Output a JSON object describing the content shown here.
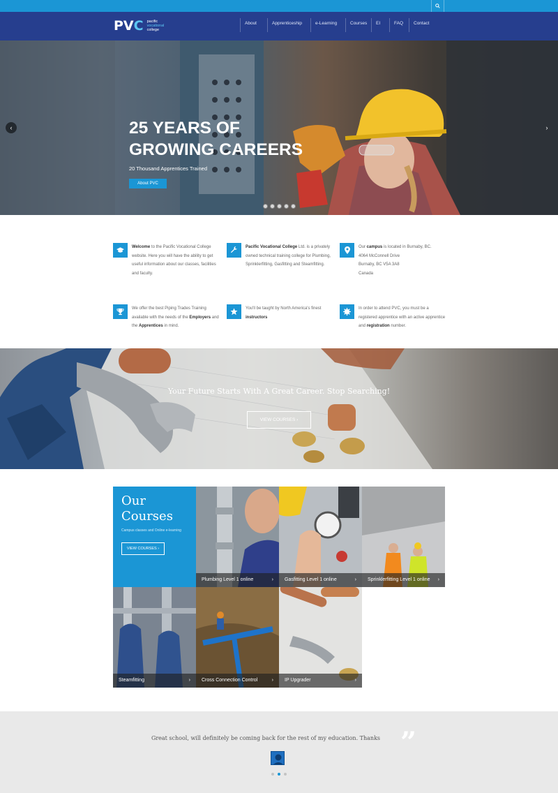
{
  "header": {
    "logo_mark_left": "PV",
    "logo_mark_right": "C",
    "logo_line1": "pacific",
    "logo_line2": "vocational",
    "logo_line3": "college",
    "nav": [
      "About",
      "Apprenticeship",
      "e-Learning",
      "Courses",
      "EI",
      "FAQ",
      "Contact"
    ]
  },
  "hero": {
    "title_line1": "25 YEARS OF",
    "title_line2": "GROWING CAREERS",
    "subtitle": "20 Thousand Apprentices Trained",
    "button": "About PVC",
    "slide_count": 5
  },
  "features": [
    {
      "icon": "graduation-cap-icon",
      "bold": "Welcome",
      "text": " to the Pacific Vocational College website. Here you will have the ability to get useful information about our classes, facilities and faculty."
    },
    {
      "icon": "wrench-icon",
      "bold": "Pacific Vocational College",
      "text": " Ltd. is a privately owned technical training college for Plumbing, Sprinklerfitting, Gasfitting and Steamfitting."
    },
    {
      "icon": "map-pin-icon",
      "pre": "Our ",
      "bold": "campus",
      "text": " is located in Burnaby, BC.",
      "lines": [
        "4064 McConnell Drive",
        "Burnaby, BC V5A 3A8",
        "Canada"
      ]
    },
    {
      "icon": "trophy-icon",
      "pre": "We offer the best Piping Trades Training available with the needs of the ",
      "bold": "Employers",
      "mid": " and the ",
      "bold2": "Apprentices",
      "text": " in mind."
    },
    {
      "icon": "star-icon",
      "pre": "You'll be taught by North America's finest ",
      "bold": "instructors",
      "text": ""
    },
    {
      "icon": "badge-icon",
      "pre": "In order to attend PVC, you must be a registered apprentice with an active apprentice and ",
      "bold": "registration",
      "text": " number."
    }
  ],
  "cta": {
    "title": "Your Future Starts With A Great Career. Stop Searching!",
    "button": "VIEW COURSES",
    "button_chevron": "›"
  },
  "courses": {
    "title_line1": "Our",
    "title_line2": "Courses",
    "subtitle": "Campus classes and Online e-learning",
    "button": "VIEW COURSES",
    "items": [
      {
        "label": "Plumbing Level 1 online"
      },
      {
        "label": "Gasfitting Level 1 online"
      },
      {
        "label": "Sprinklerfitting Level 1 online"
      },
      {
        "label": "Steamfitting"
      },
      {
        "label": "Cross Connection Control"
      },
      {
        "label": "IP Upgrader"
      }
    ]
  },
  "testimonial": {
    "quote": "Great school, will definitely be coming back for the rest of my education. Thanks",
    "quote_mark": "”",
    "slide_count": 3,
    "active_slide": 2
  },
  "colors": {
    "accent": "#1b96d5",
    "header": "#263e8e",
    "testimonial_bg": "#e9e9e9"
  }
}
